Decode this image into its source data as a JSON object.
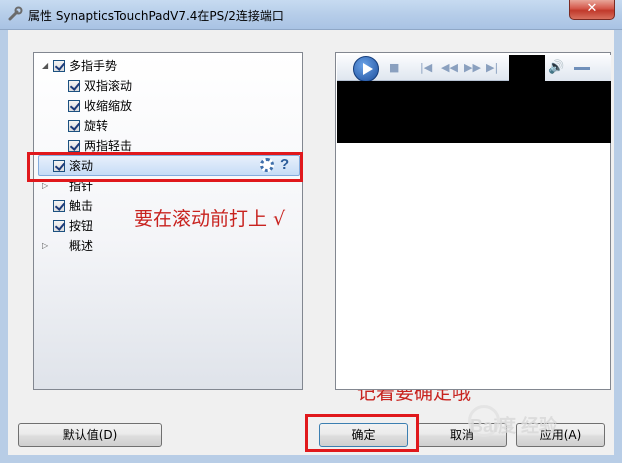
{
  "window": {
    "title": "属性 SynapticsTouchPadV7.4在PS/2连接端口",
    "close_label": "✕"
  },
  "tree": {
    "items": [
      {
        "label": "多指手势",
        "checked": true,
        "expanded": true
      },
      {
        "label": "双指滚动",
        "checked": true
      },
      {
        "label": "收缩缩放",
        "checked": true
      },
      {
        "label": "旋转",
        "checked": true
      },
      {
        "label": "两指轻击",
        "checked": true
      },
      {
        "label": "滚动",
        "checked": true,
        "selected": true
      },
      {
        "label": "指针",
        "checked": false
      },
      {
        "label": "触击",
        "checked": true
      },
      {
        "label": "按钮",
        "checked": true
      },
      {
        "label": "概述",
        "checked": false
      }
    ],
    "help_label": "?"
  },
  "annotations": {
    "scroll_hint": "要在滚动前打上 √",
    "confirm_hint": "记着要确定哦"
  },
  "buttons": {
    "default_label": "默认值(D)",
    "ok_label": "确定",
    "cancel_label": "取消",
    "apply_label": "应用(A)"
  },
  "watermark": {
    "text": "Bai度 经验"
  },
  "icons": {
    "title": "wrench-icon",
    "play": "play-icon",
    "stop": "stop-icon",
    "previous": "previous-icon",
    "rewind": "rewind-icon",
    "forward": "fast-forward-icon",
    "next": "next-icon",
    "volume": "speaker-icon",
    "settings": "gear-icon"
  },
  "colors": {
    "annotation": "#c8231f",
    "highlight_box": "#e0181c",
    "selection": "#c6dcf6"
  }
}
